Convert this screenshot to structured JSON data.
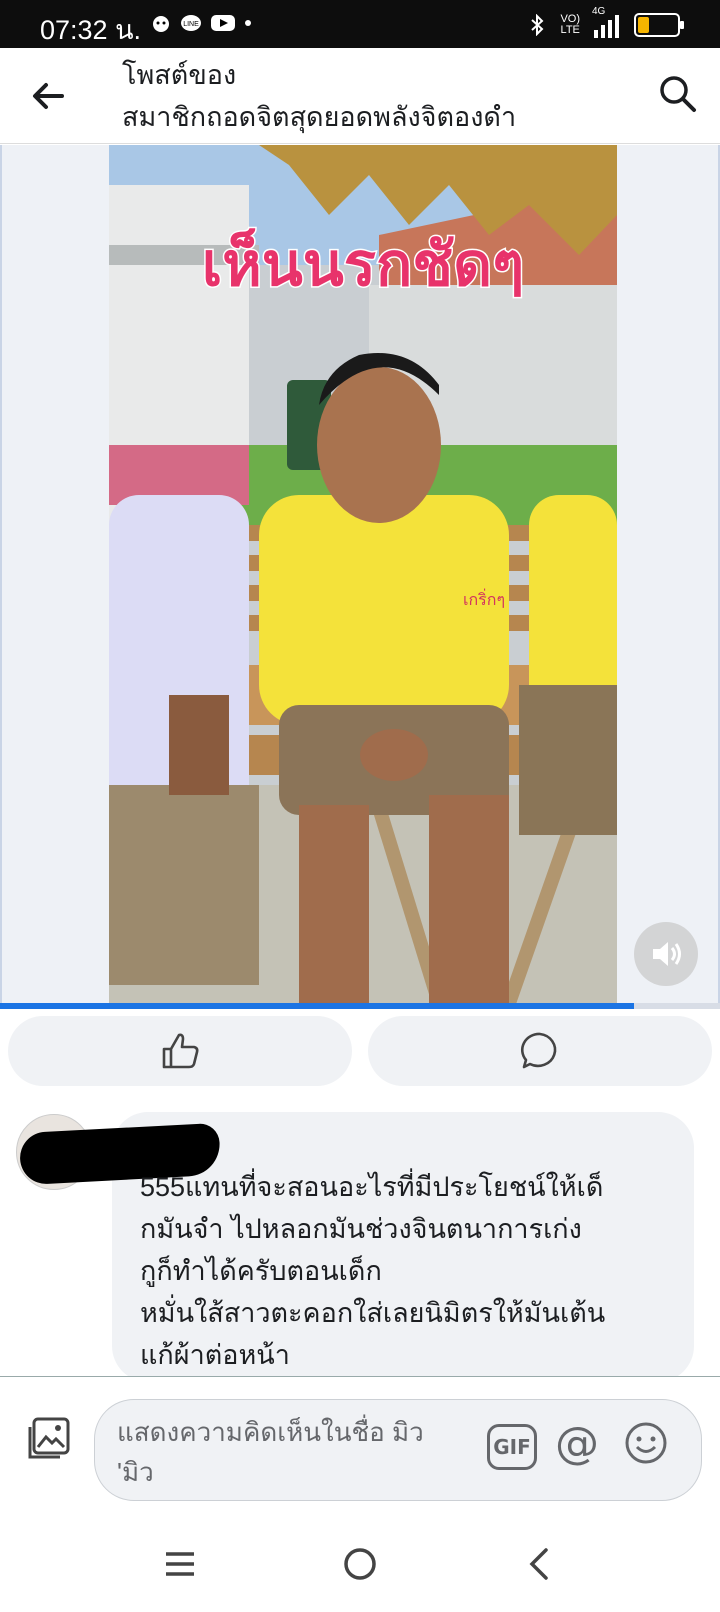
{
  "status_bar": {
    "time": "07:32 น.",
    "network_top": "VO)",
    "network_bottom": "LTE",
    "signal_type": "4G",
    "battery_level": 0.3
  },
  "header": {
    "title_line1": "โพสต์ของ",
    "title_line2": "สมาชิกถอดจิตสุดยอดพลังจิตองดำ"
  },
  "video": {
    "overlay_caption": "เห็นนรกชัดๆ",
    "progress": 0.88
  },
  "comment": {
    "text": "555แทนที่จะสอนอะไรที่มีประโยชน์ให้เด็\nกมันจำ ไปหลอกมันช่วงจินตนาการเก่ง\nกูก็ทำได้ครับตอนเด็ก\nหมั่นใส้สาวตะคอกใส่เลยนิมิตรให้มันเต้น\nแก้ผ้าต่อหน้า"
  },
  "composer": {
    "placeholder": "แสดงความคิดเห็นในชื่อ มิว 'มิว",
    "gif_label": "GIF",
    "at_label": "@"
  },
  "colors": {
    "accent": "#1b74e4",
    "caption": "#e8336b",
    "shirt": "#f4e23a"
  }
}
